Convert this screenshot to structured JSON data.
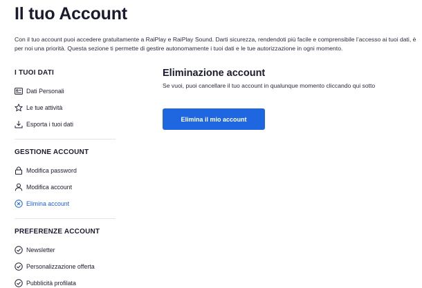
{
  "page": {
    "title": "Il tuo Account",
    "intro": "Con il tuo account puoi accedere gratuitamente a RaiPlay e RaiPlay Sound. Darti sicurezza, rendendoti più facile e comprensibile l’accesso ai tuoi dati, è per noi una priorità. Questa sezione ti permette di gestire autonomamente i tuoi dati e le tue autorizzazione in ogni momento."
  },
  "sidebar": {
    "sections": [
      {
        "heading": "I TUOI DATI",
        "items": [
          {
            "label": "Dati Personali",
            "icon": "id-card-icon"
          },
          {
            "label": "Le tue attività",
            "icon": "star-icon"
          },
          {
            "label": "Esporta i tuoi dati",
            "icon": "download-icon"
          }
        ]
      },
      {
        "heading": "GESTIONE ACCOUNT",
        "items": [
          {
            "label": "Modifica password",
            "icon": "lock-icon"
          },
          {
            "label": "Modifica account",
            "icon": "user-icon"
          },
          {
            "label": "Elimina account",
            "icon": "close-circle-icon",
            "active": true
          }
        ]
      },
      {
        "heading": "PREFERENZE ACCOUNT",
        "items": [
          {
            "label": "Newsletter",
            "icon": "check-circle-icon"
          },
          {
            "label": "Personalizzazione offerta",
            "icon": "check-circle-icon"
          },
          {
            "label": "Pubblicità profilata",
            "icon": "check-circle-icon"
          }
        ]
      }
    ]
  },
  "main": {
    "title": "Eliminazione account",
    "description": "Se vuoi, puoi cancellare il tuo account in qualunque momento cliccando qui sotto",
    "button_label": "Elimina il mio account"
  },
  "colors": {
    "accent": "#1f67e0",
    "active_link": "#1a5fd6",
    "text": "#1b1b2f"
  }
}
